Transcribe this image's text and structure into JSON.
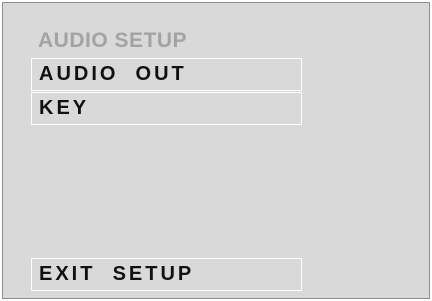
{
  "menu": {
    "title": "AUDIO SETUP",
    "items": [
      {
        "label": "AUDIO  OUT"
      },
      {
        "label": "KEY"
      }
    ],
    "exit_label": "EXIT  SETUP"
  }
}
